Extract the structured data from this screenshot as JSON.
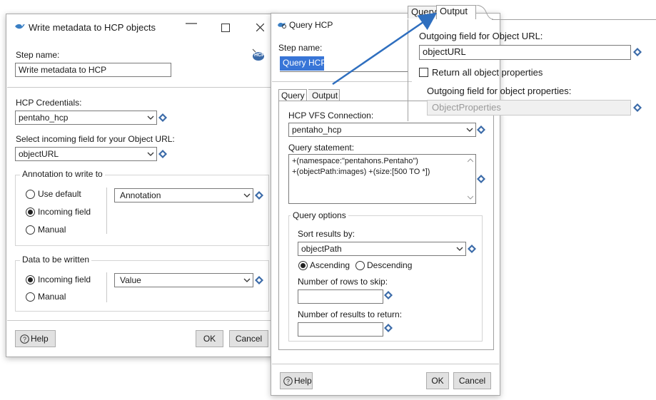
{
  "write_dialog": {
    "title": "Write metadata to HCP objects",
    "step_name_label": "Step name:",
    "step_name_value": "Write metadata to HCP",
    "credentials_label": "HCP Credentials:",
    "credentials_value": "pentaho_hcp",
    "incoming_url_label": "Select incoming field for your Object URL:",
    "incoming_url_value": "objectURL",
    "annotation_group": {
      "title": "Annotation to write to",
      "options": [
        "Use default",
        "Incoming field",
        "Manual"
      ],
      "selected": "Incoming field",
      "combo_value": "Annotation"
    },
    "data_group": {
      "title": "Data to be written",
      "options": [
        "Incoming field",
        "Manual"
      ],
      "selected": "Incoming field",
      "combo_value": "Value"
    },
    "help_label": "Help",
    "ok_label": "OK",
    "cancel_label": "Cancel",
    "hcp_badge": "HCP"
  },
  "query_dialog": {
    "title": "Query HCP",
    "step_name_label": "Step name:",
    "step_name_value": "Query HCP",
    "tabs": [
      "Query",
      "Output"
    ],
    "active_tab": "Query",
    "vfs_label": "HCP VFS Connection:",
    "vfs_value": "pentaho_hcp",
    "statement_label": "Query statement:",
    "statement_lines": [
      "+(namespace:\"pentahons.Pentaho\")",
      "+(objectPath:images) +(size:[500 TO *])"
    ],
    "query_options": {
      "title": "Query options",
      "sort_label": "Sort results by:",
      "sort_value": "objectPath",
      "order_options": [
        "Ascending",
        "Descending"
      ],
      "order_selected": "Ascending",
      "skip_label": "Number of rows to skip:",
      "skip_value": "",
      "results_label": "Number of results to return:",
      "results_value": ""
    },
    "help_label": "Help",
    "ok_label": "OK",
    "cancel_label": "Cancel"
  },
  "output_panel": {
    "tabs": [
      "Query",
      "Output"
    ],
    "active_tab": "Output",
    "outgoing_url_label": "Outgoing field for Object URL:",
    "outgoing_url_value": "objectURL",
    "return_all_label": "Return all object properties",
    "return_all_checked": false,
    "outgoing_props_label": "Outgoing field for object properties:",
    "outgoing_props_value": "ObjectProperties"
  },
  "colors": {
    "accent_blue": "#3875d7",
    "arrow_blue": "#2f6fbf",
    "variable_diamond": "#3a6aa8"
  }
}
